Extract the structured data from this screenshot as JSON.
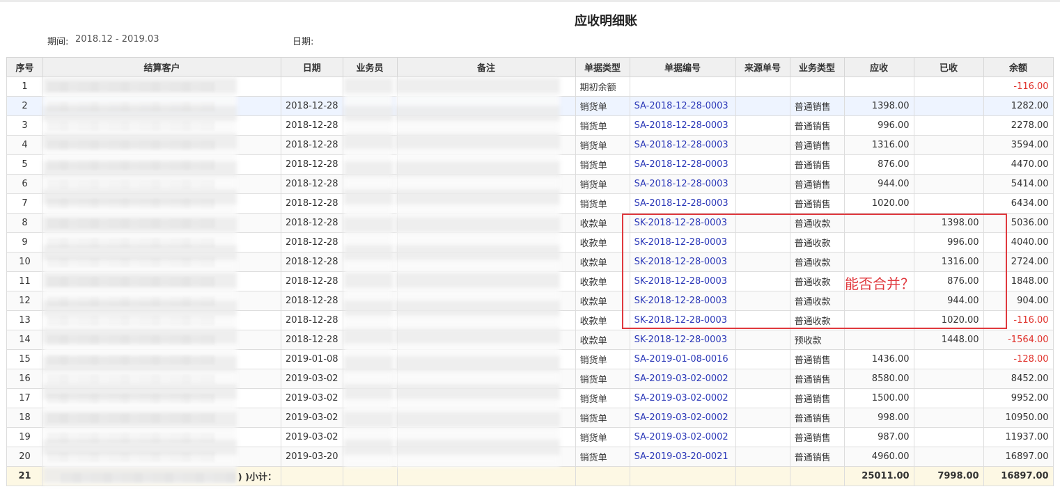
{
  "report": {
    "title": "应收明细账",
    "period_label": "期间:",
    "period_value": "2018.12 - 2019.03",
    "date_label": "日期:"
  },
  "table": {
    "columns": [
      "序号",
      "结算客户",
      "日期",
      "业务员",
      "备注",
      "单据类型",
      "单据编号",
      "来源单号",
      "业务类型",
      "应收",
      "已收",
      "余额"
    ],
    "rows": [
      {
        "idx": "1",
        "date": "",
        "doc_type": "期初余额",
        "doc_no": "",
        "biz_type": "",
        "receivable": "",
        "received": "",
        "balance": "-116.00"
      },
      {
        "idx": "2",
        "date": "2018-12-28",
        "doc_type": "销货单",
        "doc_no": "SA-2018-12-28-0003",
        "biz_type": "普通销售",
        "receivable": "1398.00",
        "received": "",
        "balance": "1282.00"
      },
      {
        "idx": "3",
        "date": "2018-12-28",
        "doc_type": "销货单",
        "doc_no": "SA-2018-12-28-0003",
        "biz_type": "普通销售",
        "receivable": "996.00",
        "received": "",
        "balance": "2278.00"
      },
      {
        "idx": "4",
        "date": "2018-12-28",
        "doc_type": "销货单",
        "doc_no": "SA-2018-12-28-0003",
        "biz_type": "普通销售",
        "receivable": "1316.00",
        "received": "",
        "balance": "3594.00"
      },
      {
        "idx": "5",
        "date": "2018-12-28",
        "doc_type": "销货单",
        "doc_no": "SA-2018-12-28-0003",
        "biz_type": "普通销售",
        "receivable": "876.00",
        "received": "",
        "balance": "4470.00"
      },
      {
        "idx": "6",
        "date": "2018-12-28",
        "doc_type": "销货单",
        "doc_no": "SA-2018-12-28-0003",
        "biz_type": "普通销售",
        "receivable": "944.00",
        "received": "",
        "balance": "5414.00"
      },
      {
        "idx": "7",
        "date": "2018-12-28",
        "doc_type": "销货单",
        "doc_no": "SA-2018-12-28-0003",
        "biz_type": "普通销售",
        "receivable": "1020.00",
        "received": "",
        "balance": "6434.00"
      },
      {
        "idx": "8",
        "date": "2018-12-28",
        "doc_type": "收款单",
        "doc_no": "SK-2018-12-28-0003",
        "biz_type": "普通收款",
        "receivable": "",
        "received": "1398.00",
        "balance": "5036.00"
      },
      {
        "idx": "9",
        "date": "2018-12-28",
        "doc_type": "收款单",
        "doc_no": "SK-2018-12-28-0003",
        "biz_type": "普通收款",
        "receivable": "",
        "received": "996.00",
        "balance": "4040.00"
      },
      {
        "idx": "10",
        "date": "2018-12-28",
        "doc_type": "收款单",
        "doc_no": "SK-2018-12-28-0003",
        "biz_type": "普通收款",
        "receivable": "",
        "received": "1316.00",
        "balance": "2724.00"
      },
      {
        "idx": "11",
        "date": "2018-12-28",
        "doc_type": "收款单",
        "doc_no": "SK-2018-12-28-0003",
        "biz_type": "普通收款",
        "receivable": "",
        "received": "876.00",
        "balance": "1848.00"
      },
      {
        "idx": "12",
        "date": "2018-12-28",
        "doc_type": "收款单",
        "doc_no": "SK-2018-12-28-0003",
        "biz_type": "普通收款",
        "receivable": "",
        "received": "944.00",
        "balance": "904.00"
      },
      {
        "idx": "13",
        "date": "2018-12-28",
        "doc_type": "收款单",
        "doc_no": "SK-2018-12-28-0003",
        "biz_type": "普通收款",
        "receivable": "",
        "received": "1020.00",
        "balance": "-116.00"
      },
      {
        "idx": "14",
        "date": "2018-12-28",
        "doc_type": "收款单",
        "doc_no": "SK-2018-12-28-0003",
        "biz_type": "预收款",
        "receivable": "",
        "received": "1448.00",
        "balance": "-1564.00"
      },
      {
        "idx": "15",
        "date": "2019-01-08",
        "doc_type": "销货单",
        "doc_no": "SA-2019-01-08-0016",
        "biz_type": "普通销售",
        "receivable": "1436.00",
        "received": "",
        "balance": "-128.00"
      },
      {
        "idx": "16",
        "date": "2019-03-02",
        "doc_type": "销货单",
        "doc_no": "SA-2019-03-02-0002",
        "biz_type": "普通销售",
        "receivable": "8580.00",
        "received": "",
        "balance": "8452.00"
      },
      {
        "idx": "17",
        "date": "2019-03-02",
        "doc_type": "销货单",
        "doc_no": "SA-2019-03-02-0002",
        "biz_type": "普通销售",
        "receivable": "1500.00",
        "received": "",
        "balance": "9952.00"
      },
      {
        "idx": "18",
        "date": "2019-03-02",
        "doc_type": "销货单",
        "doc_no": "SA-2019-03-02-0002",
        "biz_type": "普通销售",
        "receivable": "998.00",
        "received": "",
        "balance": "10950.00"
      },
      {
        "idx": "19",
        "date": "2019-03-02",
        "doc_type": "销货单",
        "doc_no": "SA-2019-03-02-0002",
        "biz_type": "普通销售",
        "receivable": "987.00",
        "received": "",
        "balance": "11937.00"
      },
      {
        "idx": "20",
        "date": "2019-03-20",
        "doc_type": "销货单",
        "doc_no": "SA-2019-03-20-0021",
        "biz_type": "普通销售",
        "receivable": "4960.00",
        "received": "",
        "balance": "16897.00"
      }
    ],
    "subtotal": {
      "idx": "21",
      "label": ") )小计：",
      "receivable": "25011.00",
      "received": "7998.00",
      "balance": "16897.00"
    }
  },
  "annotation": {
    "text": "能否合并？",
    "color": "#e0393e"
  },
  "colors": {
    "link": "#2b38b8",
    "negative": "#e0302a",
    "header_bg": "#f0f0f0",
    "subtotal_bg": "#fdf8e4"
  }
}
